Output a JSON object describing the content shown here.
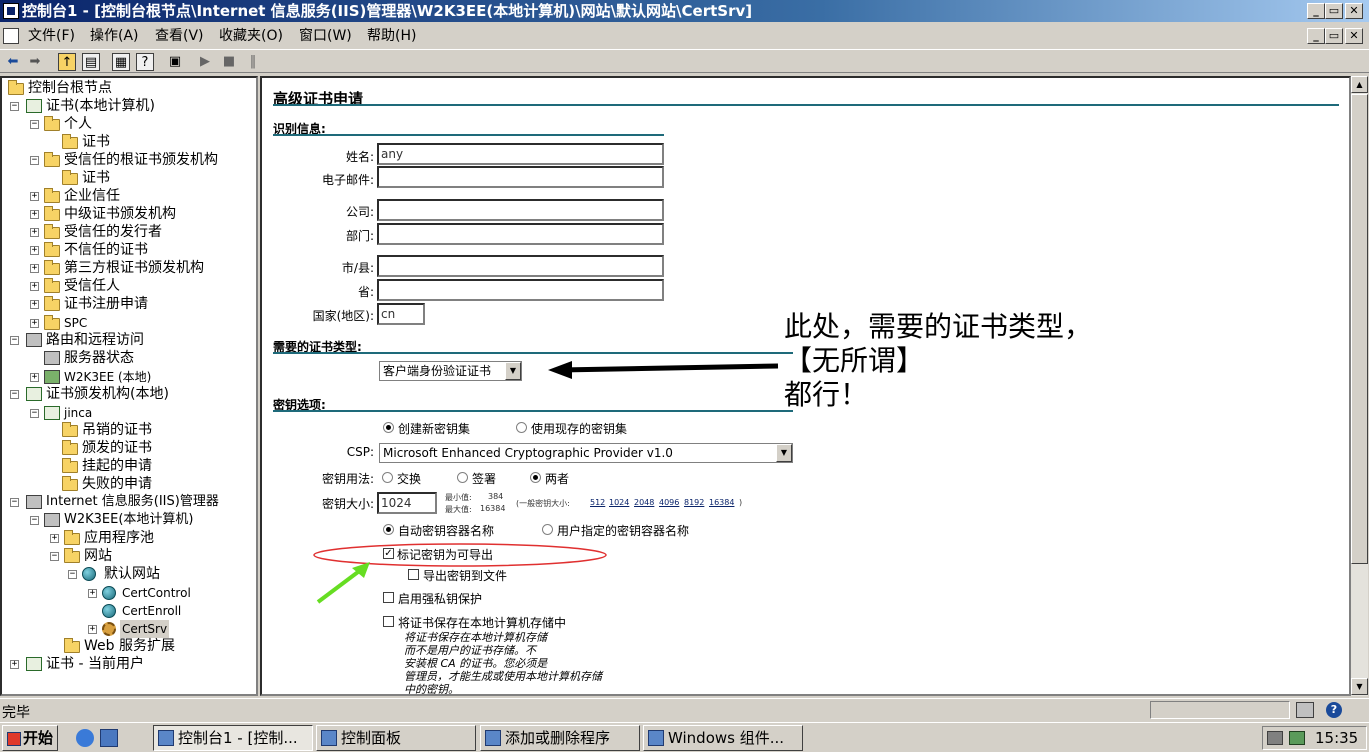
{
  "window": {
    "title": "控制台1 - [控制台根节点\\Internet 信息服务(IIS)管理器\\W2K3EE(本地计算机)\\网站\\默认网站\\CertSrv]",
    "controls": [
      "_",
      "▭",
      "✕"
    ]
  },
  "menu": {
    "items": [
      "文件(F)",
      "操作(A)",
      "查看(V)",
      "收藏夹(O)",
      "窗口(W)",
      "帮助(H)"
    ]
  },
  "toolbar": {
    "icons": [
      "back-icon",
      "forward-icon",
      "up-icon",
      "show-tree-icon",
      "properties-icon",
      "help-icon",
      "export-list-icon",
      "connect-icon",
      "play-icon",
      "stop-icon",
      "pause-icon"
    ]
  },
  "tree": {
    "nodes": [
      {
        "label": "控制台根节点"
      },
      {
        "label": "证书(本地计算机)"
      },
      {
        "label": "个人"
      },
      {
        "label": "证书"
      },
      {
        "label": "受信任的根证书颁发机构"
      },
      {
        "label": "证书"
      },
      {
        "label": "企业信任"
      },
      {
        "label": "中级证书颁发机构"
      },
      {
        "label": "受信任的发行者"
      },
      {
        "label": "不信任的证书"
      },
      {
        "label": "第三方根证书颁发机构"
      },
      {
        "label": "受信任人"
      },
      {
        "label": "证书注册申请"
      },
      {
        "label": "SPC"
      },
      {
        "label": "路由和远程访问"
      },
      {
        "label": "服务器状态"
      },
      {
        "label": "W2K3EE (本地)"
      },
      {
        "label": "证书颁发机构(本地)"
      },
      {
        "label": "jinca"
      },
      {
        "label": "吊销的证书"
      },
      {
        "label": "颁发的证书"
      },
      {
        "label": "挂起的申请"
      },
      {
        "label": "失败的申请"
      },
      {
        "label": "Internet 信息服务(IIS)管理器"
      },
      {
        "label": "W2K3EE(本地计算机)"
      },
      {
        "label": "应用程序池"
      },
      {
        "label": "网站"
      },
      {
        "label": "默认网站"
      },
      {
        "label": "CertControl"
      },
      {
        "label": "CertEnroll"
      },
      {
        "label": "CertSrv"
      },
      {
        "label": "Web 服务扩展"
      },
      {
        "label": "证书 - 当前用户"
      }
    ]
  },
  "form": {
    "title": "高级证书申请",
    "ident_heading": "识别信息:",
    "labels": {
      "name": "姓名:",
      "email": "电子邮件:",
      "company": "公司:",
      "dept": "部门:",
      "city": "市/县:",
      "state": "省:",
      "country": "国家(地区):"
    },
    "values": {
      "name": "any",
      "email": "",
      "company": "",
      "dept": "",
      "city": "",
      "state": "",
      "country": "cn"
    },
    "cert_type_heading": "需要的证书类型:",
    "cert_type_value": "客户端身份验证证书",
    "key_heading": "密钥选项:",
    "create_new": "创建新密钥集",
    "use_existing": "使用现存的密钥集",
    "csp_label": "CSP:",
    "csp_value": "Microsoft Enhanced Cryptographic Provider v1.0",
    "key_usage_label": "密钥用法:",
    "usage_exchange": "交换",
    "usage_sign": "签署",
    "usage_both": "两者",
    "key_size_label": "密钥大小:",
    "key_size_value": "1024",
    "min_label": "最小值:",
    "min_value": "384",
    "max_label": "最大值:",
    "max_value": "16384",
    "common_sizes_prefix": "(一般密钥大小:",
    "common_sizes": [
      "512",
      "1024",
      "2048",
      "4096",
      "8192",
      "16384"
    ],
    "common_sizes_suffix": ")",
    "auto_container": "自动密钥容器名称",
    "user_container": "用户指定的密钥容器名称",
    "mark_exportable": "标记密钥为可导出",
    "export_to_file": "导出密钥到文件",
    "strong_protect": "启用强私钥保护",
    "store_local": "将证书保存在本地计算机存储中",
    "note_lines": [
      "将证书保存在本地计算机存储",
      "而不是用户的证书存储。不",
      "安装根 CA 的证书。您必须是",
      "管理员，才能生成或使用本地计算机存储",
      "中的密钥。"
    ]
  },
  "annotation": {
    "lines": [
      "此处，需要的证书类型，",
      "【无所谓】",
      "都行！"
    ],
    "colors": {
      "arrow": "#000000",
      "ellipse": "#e03030",
      "green_arrow": "#66dd22"
    }
  },
  "status": {
    "text": "完毕"
  },
  "taskbar": {
    "start": "开始",
    "tasks": [
      "控制台1 - [控制...",
      "控制面板",
      "添加或删除程序",
      "Windows 组件..."
    ],
    "clock": "15:35"
  }
}
